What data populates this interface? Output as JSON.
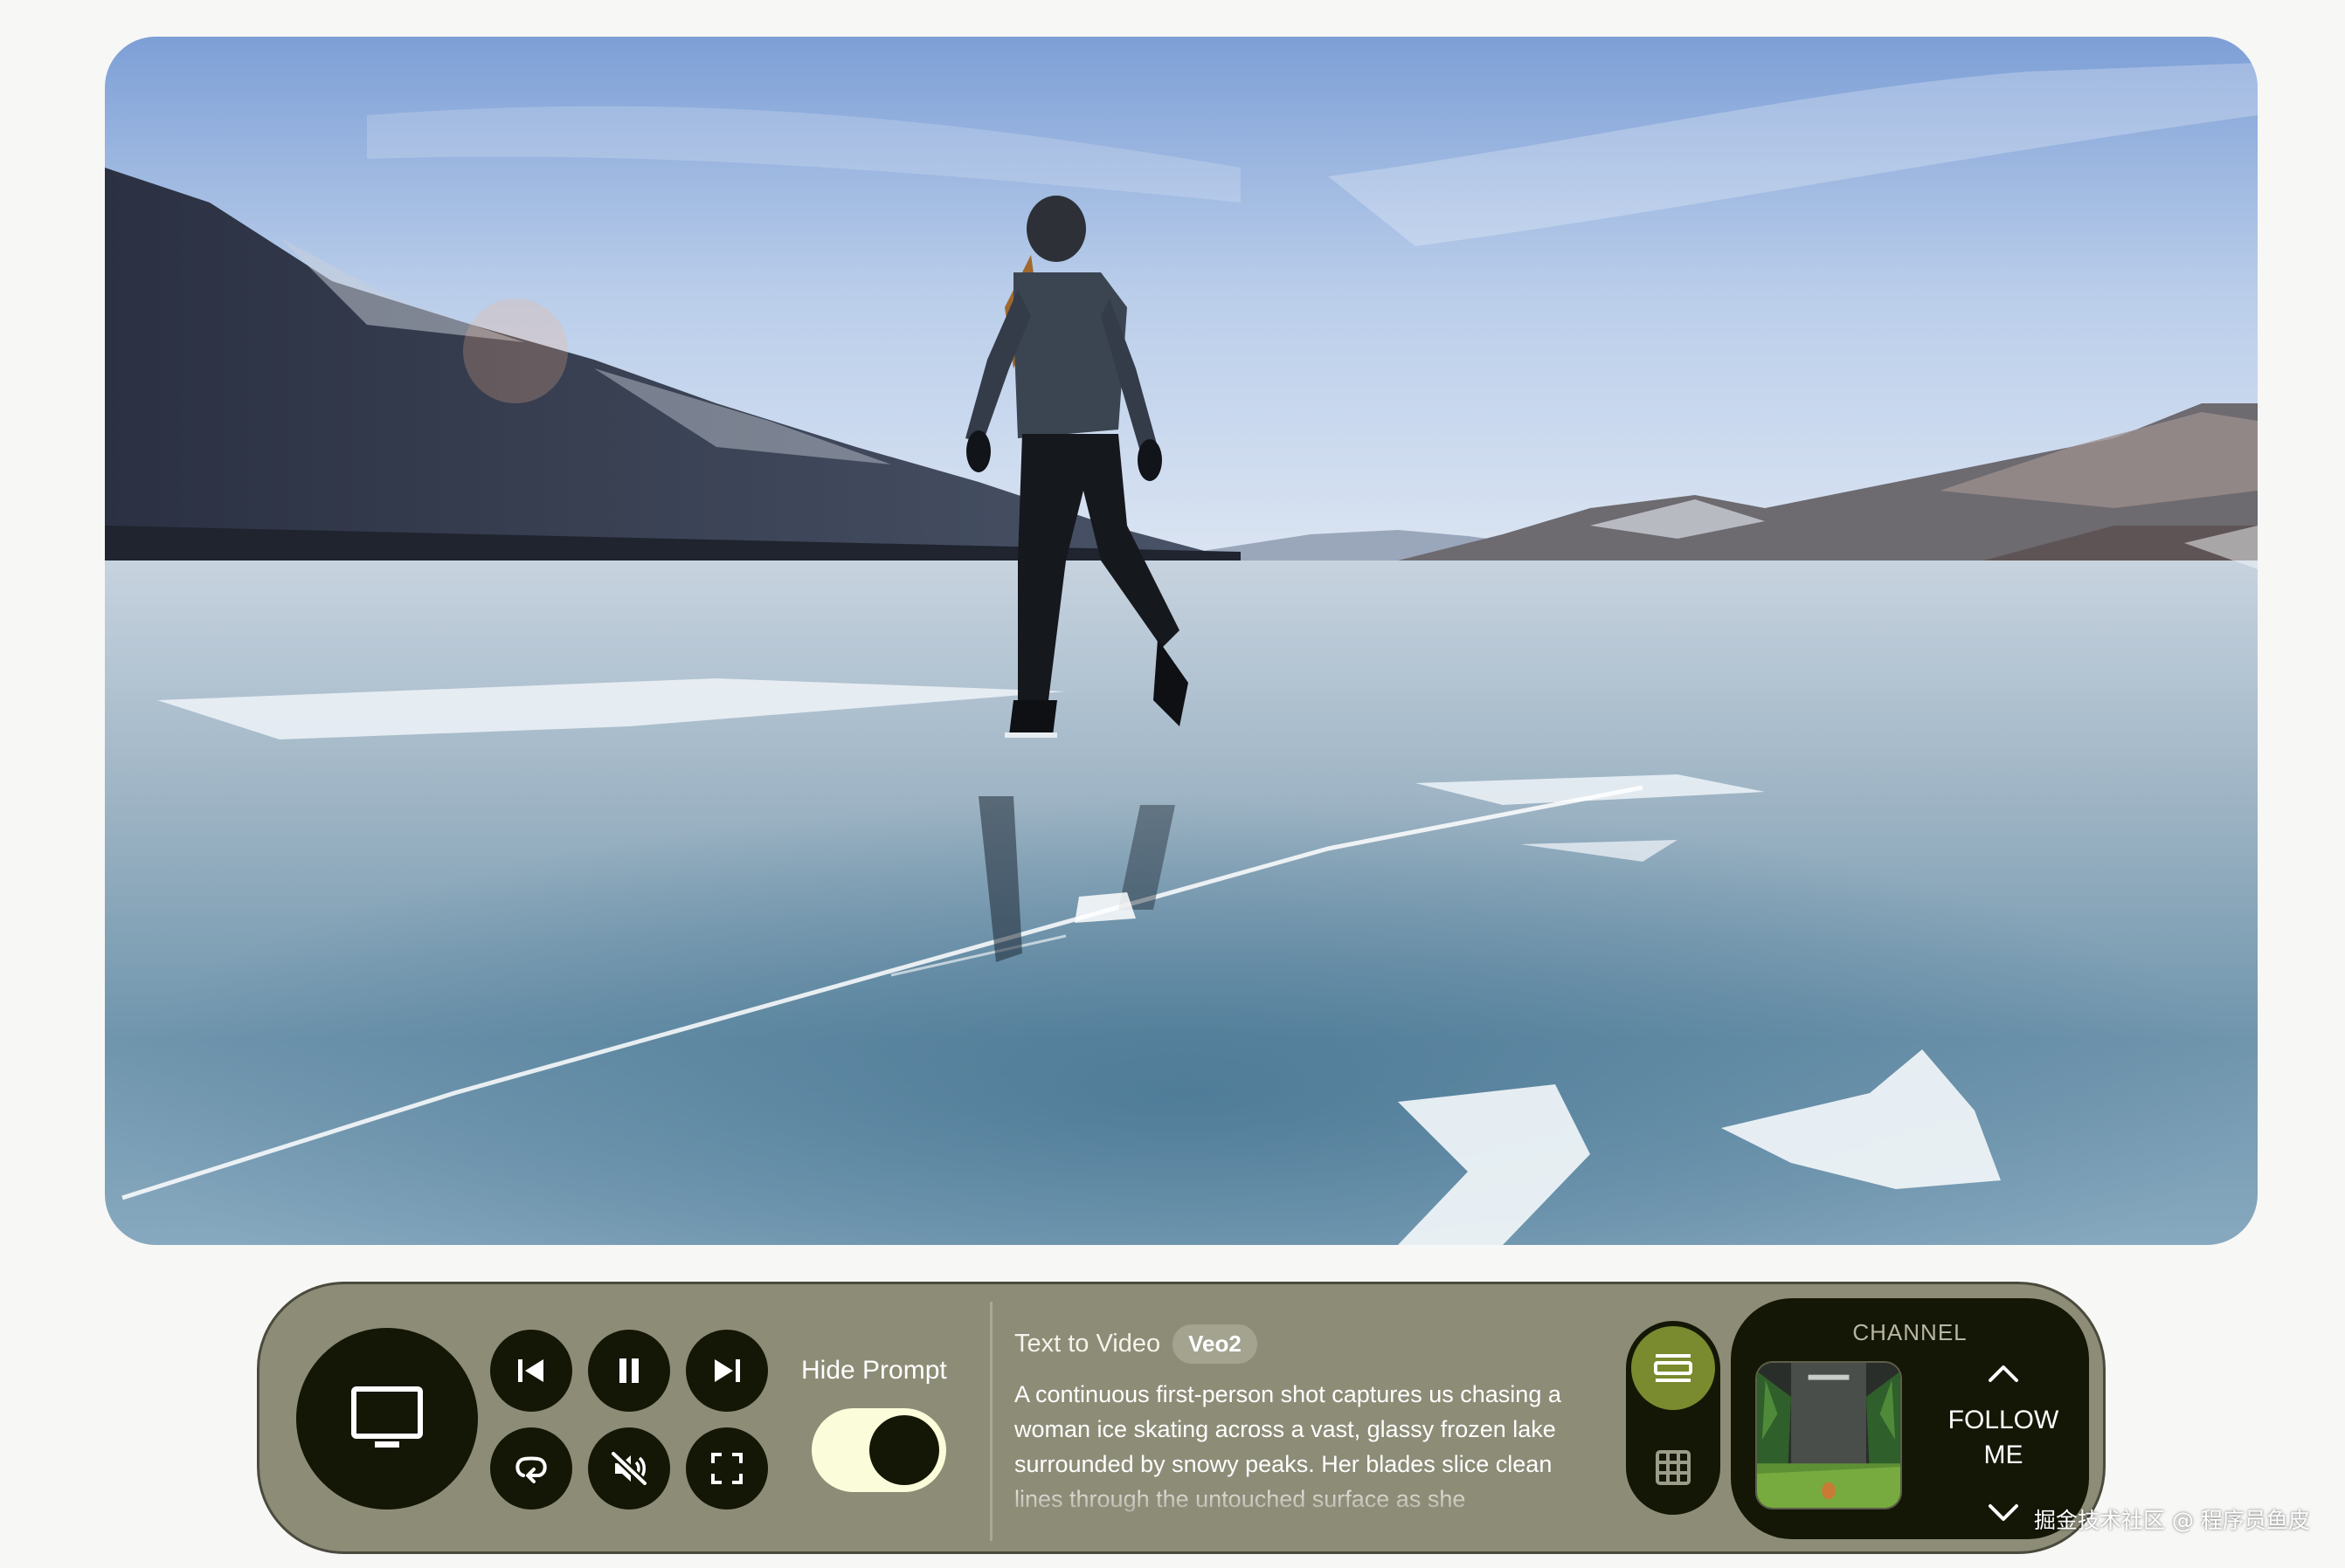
{
  "player": {
    "video_description": "",
    "is_playing": true,
    "is_muted": true
  },
  "controls": {
    "display_icon": "monitor-icon",
    "previous_icon": "skip-previous-icon",
    "pause_icon": "pause-icon",
    "next_icon": "skip-next-icon",
    "loop_icon": "loop-icon",
    "mute_icon": "volume-off-icon",
    "fullscreen_icon": "fullscreen-icon"
  },
  "prompt_toggle": {
    "label": "Hide Prompt",
    "on": true
  },
  "prompt": {
    "title": "Text to Video",
    "model": "Veo2",
    "text": "A continuous first-person shot captures us chasing a woman ice skating across a vast, glassy frozen lake surrounded by snowy peaks. Her blades slice clean lines through the untouched surface as she"
  },
  "view_switch": {
    "list_icon": "list-view-icon",
    "grid_icon": "grid-view-icon",
    "active": "list"
  },
  "channel": {
    "label": "CHANNEL",
    "up_icon": "chevron-up-icon",
    "down_icon": "chevron-down-icon",
    "name_line1": "FOLLOW",
    "name_line2": "ME"
  },
  "watermark": "掘金技术社区 @ 程序员鱼皮",
  "colors": {
    "bar_bg": "#8d8c77",
    "button_bg": "#141705",
    "toggle_track": "#fbfcd9",
    "active_view": "#7a8a2e"
  }
}
